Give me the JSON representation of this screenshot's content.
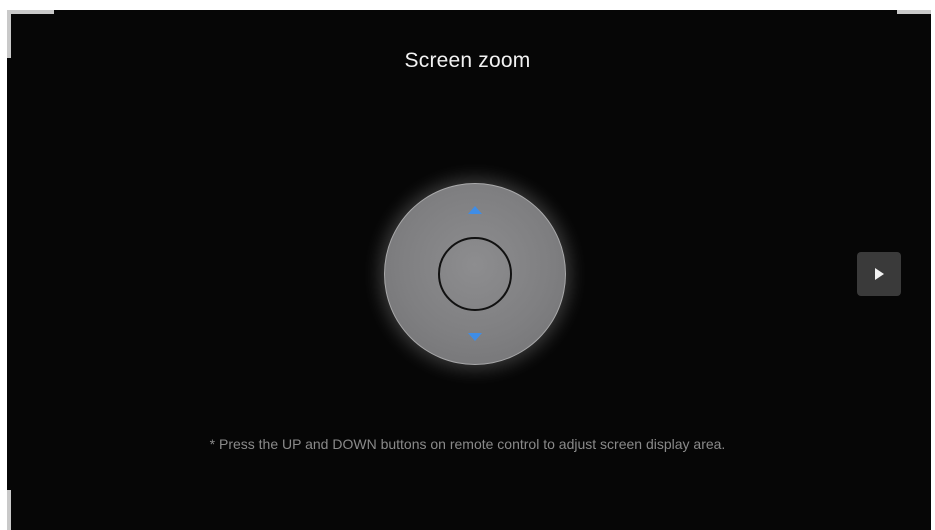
{
  "page": {
    "title": "Screen zoom",
    "hint": "* Press the UP and DOWN buttons on remote control to adjust screen display area."
  },
  "dpad": {
    "up_icon": "triangle-up-icon",
    "down_icon": "triangle-down-icon",
    "arrow_color": "#3f8de6"
  },
  "next_button": {
    "icon": "play-icon"
  },
  "colors": {
    "background": "#060606",
    "corner_markers": "#c9c9c9",
    "title_text": "#f2f2f2",
    "hint_text": "#8a8a8a",
    "button_bg": "#3a3a3a"
  }
}
